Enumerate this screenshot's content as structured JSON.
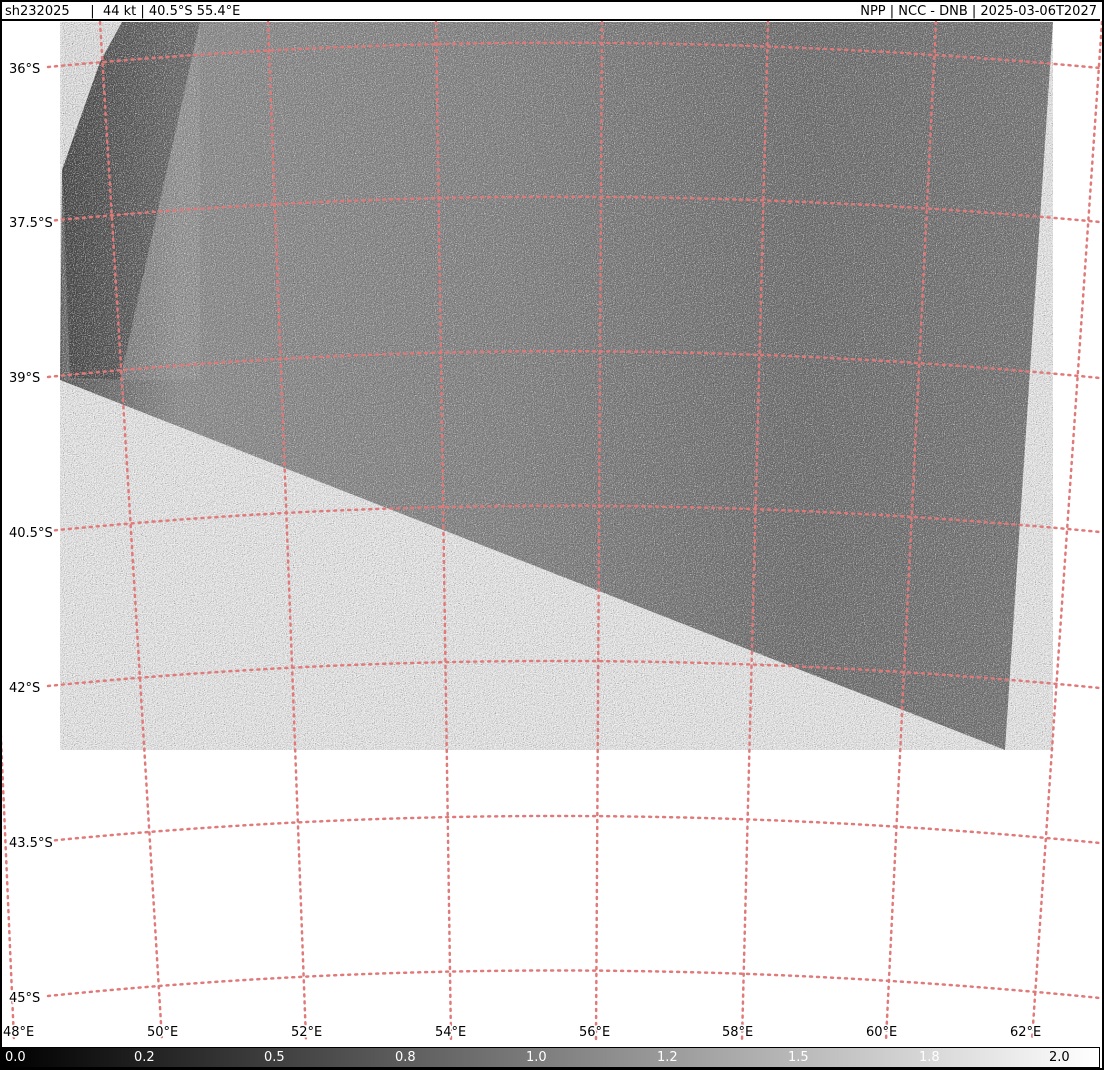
{
  "header": {
    "left_text": "sh232025     |  44 kt | 40.5°S 55.4°E",
    "right_text": "NPP | NCC - DNB | 2025-03-06T2027"
  },
  "map": {
    "lat_labels": [
      "36°S",
      "37.5°S",
      "39°S",
      "40.5°S",
      "42°S",
      "43.5°S",
      "45°S"
    ],
    "lon_labels": [
      "48°E",
      "50°E",
      "52°E",
      "54°E",
      "56°E",
      "58°E",
      "60°E",
      "62°E"
    ],
    "grid_color": "#e07070",
    "imagery_base_color": "#7a7a7a"
  },
  "colorbar": {
    "ticks": [
      "0.0",
      "0.2",
      "0.5",
      "0.8",
      "1.0",
      "1.2",
      "1.5",
      "1.8",
      "2.0"
    ],
    "gradient_start": "#000000",
    "gradient_end": "#ffffff"
  }
}
